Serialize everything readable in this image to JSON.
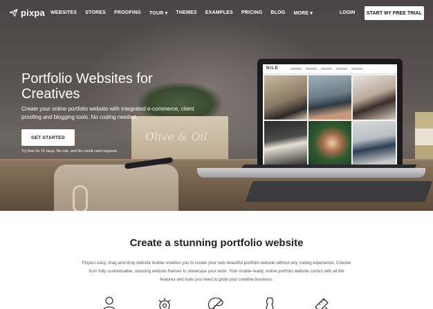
{
  "nav": {
    "logo_text": "pixpa",
    "links": [
      "WEBSITES",
      "STORES",
      "PROOFING",
      "TOUR ▾",
      "THEMES",
      "EXAMPLES",
      "PRICING",
      "BLOG",
      "MORE ▾"
    ],
    "login": "LOGIN",
    "trial_button": "START MY FREE TRIAL"
  },
  "hero": {
    "title": "Portfolio Websites for Creatives",
    "subtitle": "Create your online portfolio website with integrated e-commerce, client proofing and blogging tools. No coding needed.",
    "cta": "GET STARTED",
    "note": "Try free for 15 days. No risk, and No credit card required.",
    "box_text": "Olive & Oil",
    "mockup_logo": "NILE"
  },
  "section": {
    "title": "Create a stunning portfolio website",
    "description": "Pixpa's easy, drag-and-drop website builder enables you to create your own beautiful portfolio website without any coding experience. Choose from fully customisable, stunning website themes to showcase your work. Your mobile-ready, online portfolio website comes with all the features and tools you need to grow your creative business."
  },
  "features": {
    "icons": [
      "person-icon",
      "gears-icon",
      "palette-icon",
      "dress-form-icon",
      "pencil-ruler-icon"
    ]
  }
}
